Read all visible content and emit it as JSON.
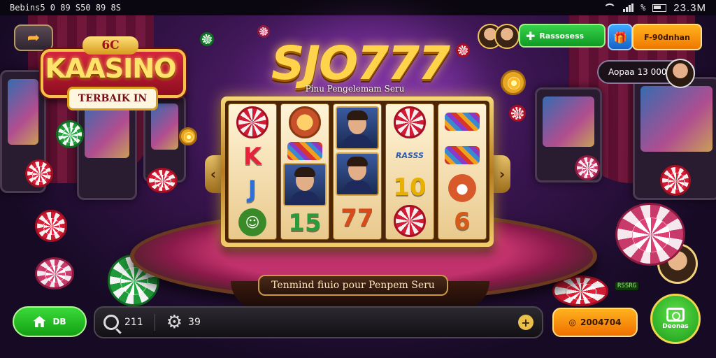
{
  "status_bar": {
    "left_text": "Bebins5 0 89 S50 89 8S",
    "battery_pct": "%",
    "time": "23.3M"
  },
  "header": {
    "logo_top": "6C",
    "logo_main": "KAASINO",
    "logo_sub": "TERBAIK IN",
    "title": "SJO777",
    "subtitle": "Pinu Pengelemam Seru"
  },
  "top_controls": {
    "green_button": "Rassosess",
    "orange_button": "F-90dnhan",
    "player_balance": "Aopaa 13 000"
  },
  "slot": {
    "reels": [
      [
        {
          "kind": "chip",
          "label": ""
        },
        {
          "kind": "letter",
          "label": "K",
          "color": "#e8223a"
        },
        {
          "kind": "letter",
          "label": "J",
          "color": "#2e6fd8"
        },
        {
          "kind": "icon",
          "label": "☺",
          "color": "#3a8a2a"
        }
      ],
      [
        {
          "kind": "badge",
          "label": "",
          "color": "#c8502a"
        },
        {
          "kind": "gems",
          "label": ""
        },
        {
          "kind": "portrait",
          "label": ""
        },
        {
          "kind": "letter",
          "label": "15",
          "color": "#2a9a3a"
        }
      ],
      [
        {
          "kind": "portrait",
          "label": ""
        },
        {
          "kind": "portrait",
          "label": ""
        },
        {
          "kind": "letter",
          "label": "77",
          "color": "#d84a1a"
        }
      ],
      [
        {
          "kind": "chip",
          "label": ""
        },
        {
          "kind": "text",
          "label": "RASSS",
          "color": "#2a5ab0"
        },
        {
          "kind": "letter",
          "label": "10",
          "color": "#e8b000"
        },
        {
          "kind": "chip",
          "label": ""
        }
      ],
      [
        {
          "kind": "gems",
          "label": ""
        },
        {
          "kind": "gems",
          "label": ""
        },
        {
          "kind": "icon",
          "label": "●",
          "color": "#d85a2a"
        },
        {
          "kind": "letter",
          "label": "6",
          "color": "#d85a1a"
        }
      ]
    ]
  },
  "table_banner": "Tenmind fiuio pour Penpem Seru",
  "bottom_bar": {
    "home_label": "DB",
    "search_count": "211",
    "settings_count": "39",
    "coin_button": "2004704",
    "camera_label": "Deonas",
    "small_tag": "RSSRG"
  },
  "colors": {
    "accent_gold": "#ffd44a",
    "accent_green": "#2ac83a",
    "accent_orange": "#f89a10"
  }
}
